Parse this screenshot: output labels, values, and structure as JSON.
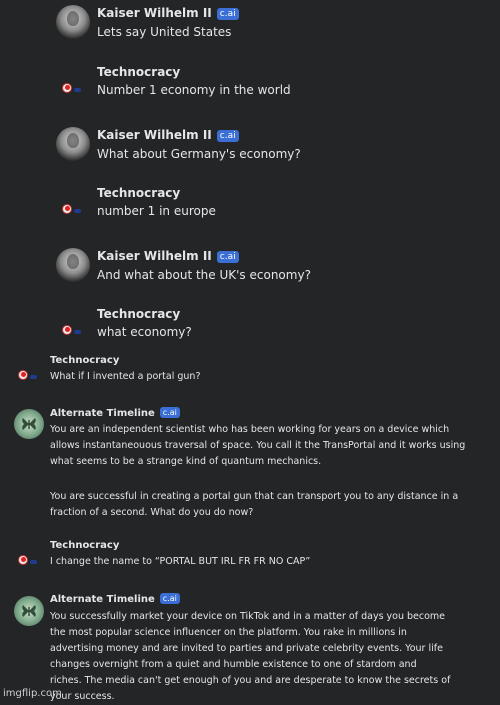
{
  "chat": {
    "messages": [
      {
        "author": "Kaiser Wilhelm II",
        "badge": "c.ai",
        "text": "Lets say United States"
      },
      {
        "author": "Technocracy",
        "text": "Number 1 economy in the world"
      },
      {
        "author": "Kaiser Wilhelm II",
        "badge": "c.ai",
        "text": "What about Germany's economy?"
      },
      {
        "author": "Technocracy",
        "text": "number 1 in europe"
      },
      {
        "author": "Kaiser Wilhelm II",
        "badge": "c.ai",
        "text": "And what about the UK's economy?"
      },
      {
        "author": "Technocracy",
        "text": "what economy?"
      },
      {
        "author": "Technocracy",
        "text": "What if I invented a portal gun?"
      },
      {
        "author": "Alternate Timeline",
        "badge": "c.ai",
        "lines": [
          "You are an independent scientist who has been working for years on a device which",
          "allows instantaneouous traversal of space. You call it the TransPortal and it works using",
          "what seems to be a strange kind of quantum mechanics.",
          "",
          "You are successful in creating a portal gun that can transport you to any distance in a",
          "fraction of a second. What do you do now?"
        ]
      },
      {
        "author": "Technocracy",
        "text": "I change the name to “PORTAL BUT IRL FR FR NO CAP”"
      },
      {
        "author": "Alternate Timeline",
        "badge": "c.ai",
        "lines": [
          "You successfully market your device on TikTok and in a matter of days you become",
          "the most popular science influencer on the platform. You rake in millions in",
          "advertising money and are invited to parties and private celebrity events. Your life",
          "changes overnight from a quiet and humble existence to one of stardom and",
          "riches. The media can't get enough of you and are desperate to know the secrets of",
          "your success."
        ]
      }
    ]
  },
  "watermark": "imgflip.com",
  "colors": {
    "background": "#242526",
    "badge": "#3b6fd6",
    "text": "#e4e6ea"
  }
}
